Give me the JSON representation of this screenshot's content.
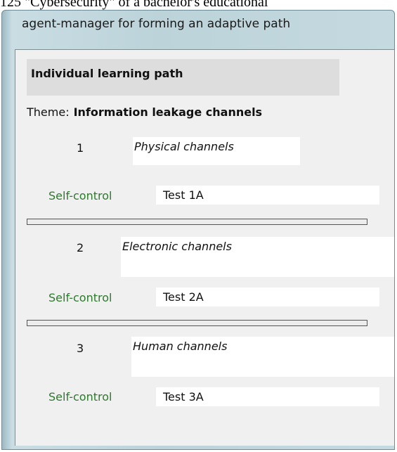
{
  "caption": "125 \"Cybersecurity\" of a bachelor's educational",
  "window": {
    "title": "agent-manager for forming an adaptive path"
  },
  "path": {
    "heading": "Individual learning path",
    "theme_label": "Theme:",
    "theme_value": "Information leakage channels",
    "items": [
      {
        "number": "1",
        "topic": "Physical channels",
        "self_control_label": "Self-control",
        "test": "Test 1A",
        "progress": 0
      },
      {
        "number": "2",
        "topic": "Electronic channels",
        "self_control_label": "Self-control",
        "test": "Test 2A",
        "progress": 0
      },
      {
        "number": "3",
        "topic": "Human channels",
        "self_control_label": "Self-control",
        "test": "Test 3A"
      }
    ]
  },
  "colors": {
    "self_control": "#2c7a2c",
    "window_frame": "#c5dae0",
    "client_bg": "#f0f0f0"
  }
}
